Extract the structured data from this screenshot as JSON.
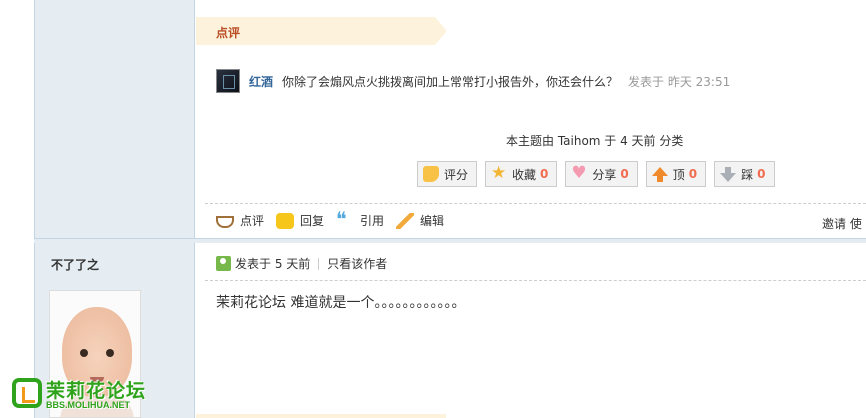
{
  "comment_section": {
    "tab_label": "点评",
    "comment": {
      "author": "红酒",
      "text": "你除了会煽风点火挑拨离间加上常常打小报告外，你还会什么？",
      "time": "发表于 昨天 23:51"
    }
  },
  "thread": {
    "meta_text": "本主题由 Taihom 于 4 天前 分类"
  },
  "action_buttons": [
    {
      "label": "评分",
      "count": "",
      "icon": "thumbs-up-icon"
    },
    {
      "label": "收藏",
      "count": "0",
      "icon": "star-icon"
    },
    {
      "label": "分享",
      "count": "0",
      "icon": "heart-icon"
    },
    {
      "label": "顶",
      "count": "0",
      "icon": "arrow-up-icon"
    },
    {
      "label": "踩",
      "count": "0",
      "icon": "arrow-down-icon"
    }
  ],
  "footer_actions": {
    "comment": "点评",
    "reply": "回复",
    "quote": "引用",
    "edit": "编辑",
    "invite": "邀请 使"
  },
  "post2": {
    "username": "不了了之",
    "posted": "发表于 5 天前",
    "only_author": "只看该作者",
    "body": "茉莉花论坛 难道就是一个。。。。。。。。。。。。"
  },
  "watermark": {
    "name_cn": "茉莉花论坛",
    "name_en": "BBS.MOLIHUA.NET"
  },
  "colors": {
    "sidebar_bg": "#e5edf2",
    "tab_bg": "#fdf3dc",
    "accent_red": "#ba4c25",
    "link_blue": "#336699",
    "count_orange": "#f26c4f",
    "logo_green": "#2ea31b"
  }
}
